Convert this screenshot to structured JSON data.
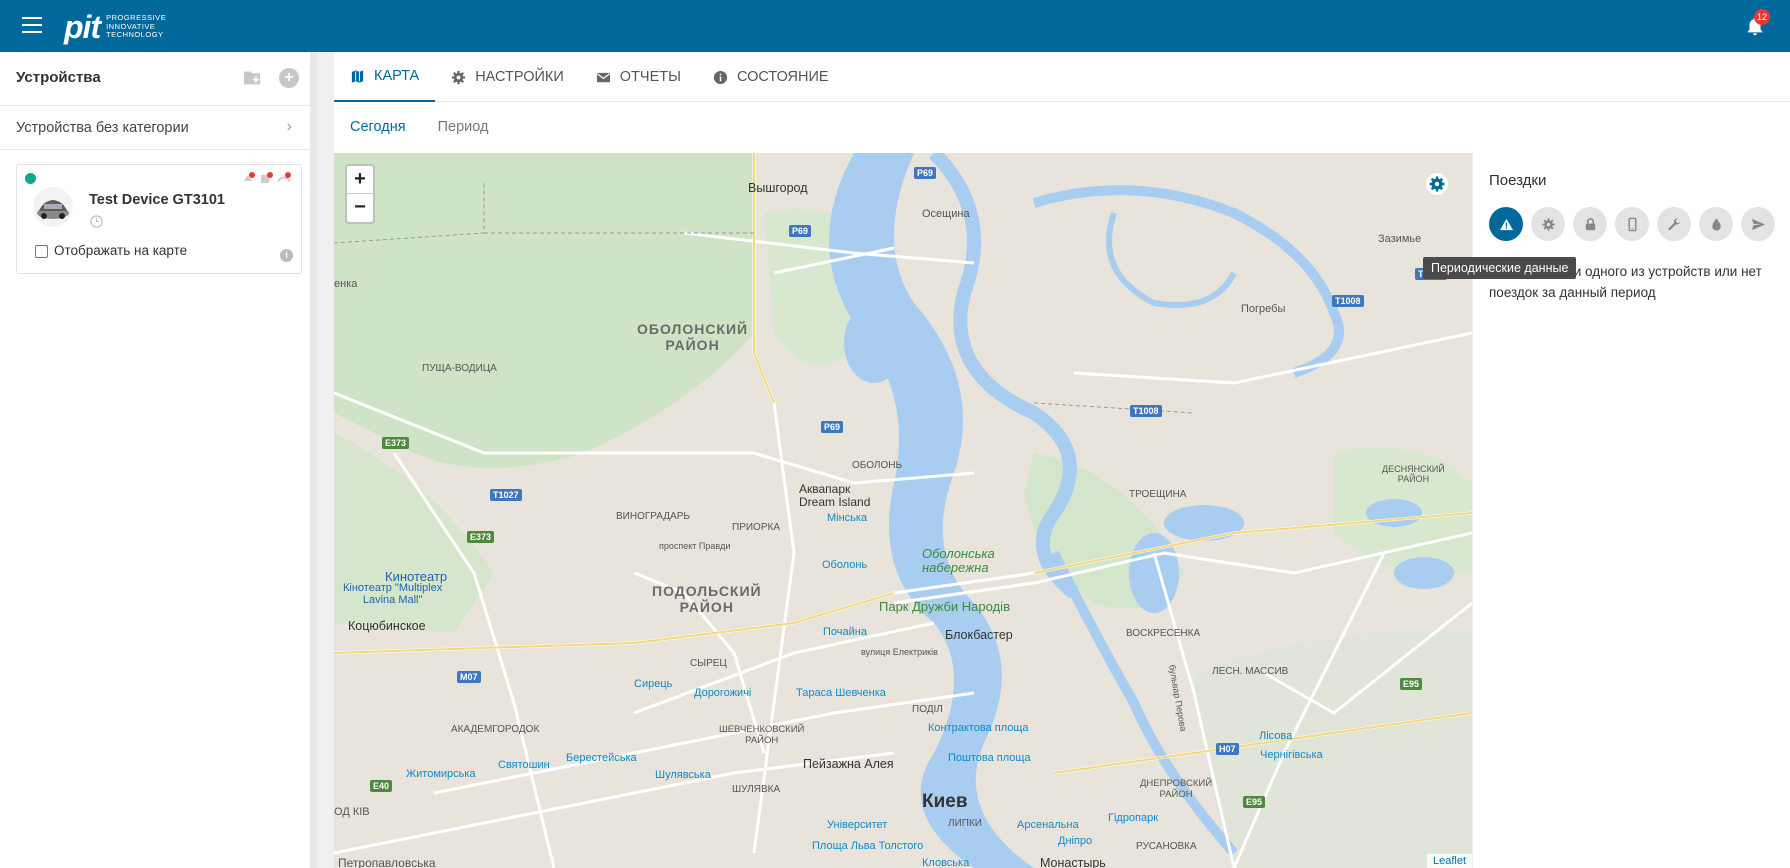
{
  "header": {
    "logo_mark": "pit",
    "logo_text_1": "PROGRESSIVE",
    "logo_text_2": "INNOVATIVE",
    "logo_text_3": "TECHNOLOGY",
    "notifications_count": "12",
    "icons": [
      "menu-icon",
      "bell-icon"
    ],
    "bar_color": "#00689b"
  },
  "sidebar": {
    "title": "Устройства",
    "category_label": "Устройства без категории",
    "device": {
      "name": "Test Device GT3101",
      "show_on_map_label": "Отображать на карте",
      "status_color": "#17a589"
    }
  },
  "tabs": [
    {
      "label": "КАРТА",
      "icon": "map-icon"
    },
    {
      "label": "НАСТРОЙКИ",
      "icon": "gear-icon"
    },
    {
      "label": "ОТЧЕТЫ",
      "icon": "mail-icon"
    },
    {
      "label": "СОСТОЯНИЕ",
      "icon": "info-icon"
    }
  ],
  "subtabs": [
    "Сегодня",
    "Период"
  ],
  "map": {
    "zoom_in": "+",
    "zoom_out": "−",
    "attribution": "Leaflet",
    "labels": {
      "vyshgorod": "Вышгород",
      "osescina": "Осещина",
      "zazimie": "Зазимье",
      "pogrebi": "Погребы",
      "obolon_district": "ОБОЛОНСКИЙ\nРАЙОН",
      "pusha": "ПУЩА-ВОДИЦА",
      "obolon": "ОБОЛОНЬ",
      "aquapark": "Аквапарк\nDream Island",
      "minska": "Мінська",
      "vinogradar": "ВИНОГРАДАРЬ",
      "priorka": "ПРИОРКА",
      "prospekt": "проспект Правди",
      "obolon_m": "Оболонь",
      "oboln_nab": "Оболонська\nнабережна",
      "troeshina": "ТРОЕЩИНА",
      "desn": "ДЕСНЯНСКИЙ\nРАЙОН",
      "kino": "Кинотеатр",
      "kino2": "Кінотеатр \"Multiplex\nLavina Mall\"",
      "podil_district": "ПОДОЛЬСКИЙ\nРАЙОН",
      "park": "Парк Дружби Народів",
      "blockbaster": "Блокбастер",
      "kotsyub": "Коцюбинское",
      "pochaina": "Почайна",
      "syrets": "СЫРЕЦ",
      "voskres": "ВОСКРЕСЕНКА",
      "lesn": "ЛЕСН. МАССИВ",
      "syrets_m": "Сирець",
      "doroh": "Дорогожичі",
      "taras": "Тараса Шевченка",
      "podil": "ПОДІЛ",
      "akadem": "АКАДЕМГОРОДОК",
      "shevch": "ШЕВЧЕНКОВСКИЙ\nРАЙОН",
      "kontr": "Контрактова площа",
      "lisova": "Лісова",
      "chernig": "Чернігівська",
      "svyat": "Святошин",
      "beres": "Берестейська",
      "peyzazh": "Пейзажна Алея",
      "poshtova": "Поштова площа",
      "dnepr": "ДНЕПРОВСКИЙ\nРАЙОН",
      "zhyt": "Житомирська",
      "shulyav": "Шулявська",
      "shulyav2": "ШУЛЯВКА",
      "kiev": "Киев",
      "univ": "Університет",
      "lypky": "ЛИПКИ",
      "arsen": "Арсенальна",
      "gidro": "Гідропарк",
      "rusan": "РУСАНОВКА",
      "lva": "Площа Льва Толстого",
      "dnipro": "Дніпро",
      "klov": "Кловська",
      "monast": "Монастырь",
      "petro": "Петропавловська",
      "odkiv": "ОД КІВ",
      "enka": "енка",
      "bulvar": "бульвар Перова",
      "elektr": "вулиця Електриків"
    },
    "shields": [
      "Р69",
      "Р69",
      "Р69",
      "Т1008",
      "Т1008",
      "Т1008",
      "Е373",
      "Т1027",
      "Е373",
      "М07",
      "Е40",
      "Н07",
      "Е95",
      "Е95"
    ]
  },
  "trips": {
    "title": "Поездки",
    "tools": [
      "warning-icon",
      "gear-icon",
      "lock-icon",
      "phone-icon",
      "wrench-icon",
      "drop-icon",
      "send-icon"
    ],
    "tooltip": "Периодические данные",
    "message": "Нет данных ни одного из устройств или нет поездок за данный период",
    "active_color": "#00689b"
  }
}
